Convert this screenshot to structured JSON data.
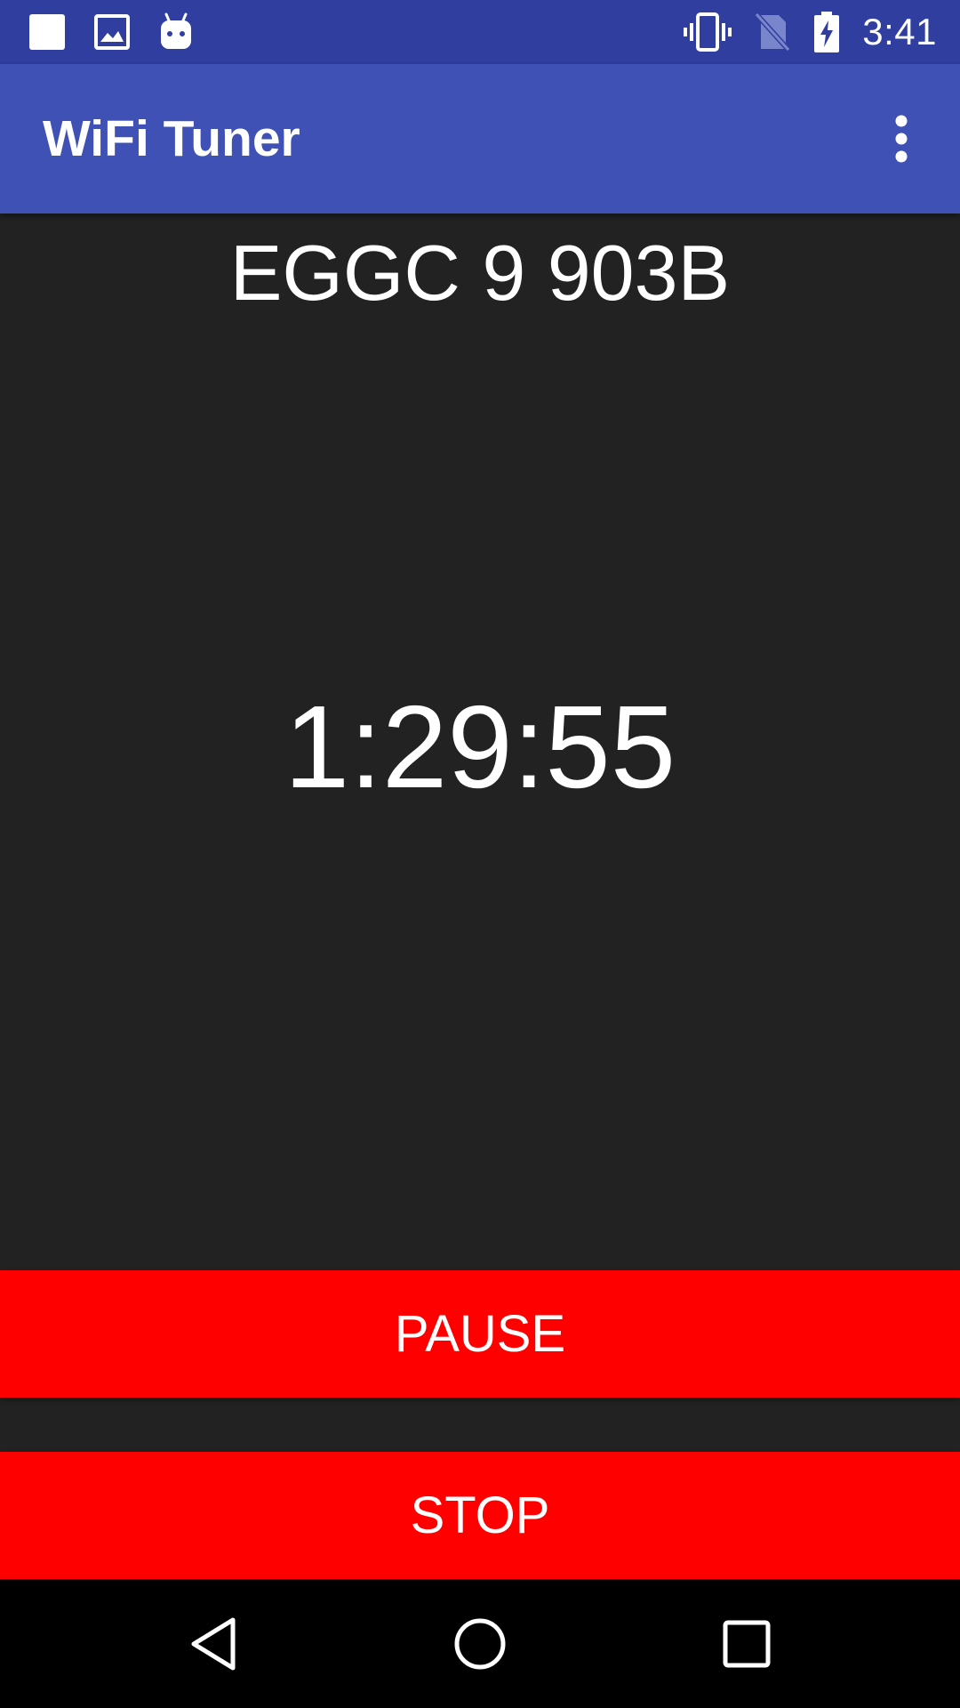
{
  "status_bar": {
    "time": "3:41",
    "left_icons": [
      "square-notification-icon",
      "image-notification-icon",
      "android-notification-icon"
    ],
    "right_icons": [
      "vibrate-icon",
      "no-sim-icon",
      "battery-charging-icon"
    ],
    "background_color": "#303F9F"
  },
  "app_bar": {
    "title": "WiFi Tuner",
    "menu_icon": "more-vert-icon",
    "background_color": "#3F51B5"
  },
  "main": {
    "network_name": "EGGC 9 903B",
    "timer": "1:29:55"
  },
  "buttons": {
    "pause_label": "PAUSE",
    "stop_label": "STOP",
    "color": "#FF0000"
  },
  "nav_bar": {
    "icons": [
      "back-icon",
      "home-icon",
      "recents-icon"
    ]
  }
}
